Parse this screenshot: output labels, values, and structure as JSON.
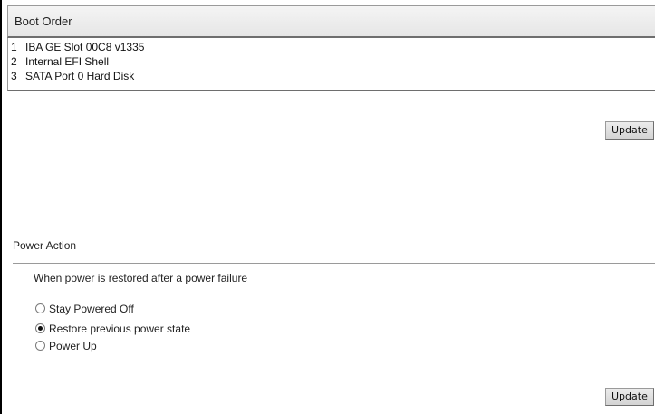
{
  "boot_order": {
    "title": "Boot Order",
    "items": [
      {
        "num": "1",
        "label": "IBA GE Slot 00C8 v1335"
      },
      {
        "num": "2",
        "label": "Internal EFI Shell"
      },
      {
        "num": "3",
        "label": "SATA Port 0 Hard Disk"
      }
    ],
    "update_label": "Update"
  },
  "power_action": {
    "title": "Power Action",
    "description": "When power is restored after a power failure",
    "options": [
      {
        "label": "Stay Powered Off",
        "checked": false
      },
      {
        "label": "Restore previous power state",
        "checked": true
      },
      {
        "label": "Power Up",
        "checked": false
      }
    ],
    "update_label": "Update"
  }
}
